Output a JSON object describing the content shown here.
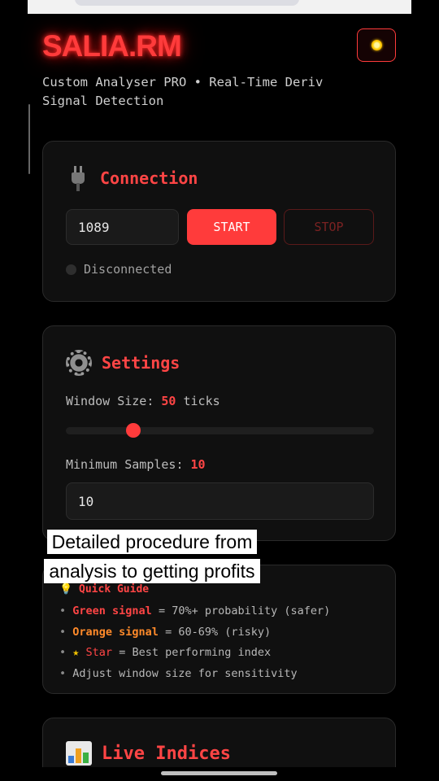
{
  "header": {
    "brand": "SALIA.RM",
    "subtitle": "Custom Analyser PRO • Real-Time Deriv Signal Detection",
    "theme_icon": "sun-icon"
  },
  "connection": {
    "icon": "plug-icon",
    "title": "Connection",
    "app_id_value": "1089",
    "start_label": "START",
    "stop_label": "STOP",
    "status_text": "Disconnected",
    "colors": {
      "accent": "#ff3b3b",
      "status_dot": "#2e2e2e"
    }
  },
  "settings": {
    "icon": "gear-icon",
    "title": "Settings",
    "window_label": "Window Size:",
    "window_value": "50",
    "window_unit": "ticks",
    "window_slider_fraction": 0.22,
    "min_samples_label": "Minimum Samples:",
    "min_samples_value": "10",
    "min_samples_input": "10"
  },
  "overlay": {
    "caption_line1": "Detailed procedure from",
    "caption_line2": "analysis to getting profits"
  },
  "guide": {
    "icon": "lightbulb-icon",
    "title": "Quick Guide",
    "items": [
      {
        "highlight": "Green signal",
        "text": " = 70%+ probability (safer)"
      },
      {
        "highlight": "Orange signal",
        "text": " = 60-69% (risky)"
      },
      {
        "highlight": "Star",
        "text": " = Best performing index"
      },
      {
        "highlight": "",
        "text": "Adjust window size for sensitivity"
      }
    ],
    "colors": {
      "green": "#ff4545",
      "orange": "#ff8a2a",
      "star": "#f5c400"
    }
  },
  "live": {
    "icon": "bar-chart-icon",
    "title": "Live Indices"
  }
}
